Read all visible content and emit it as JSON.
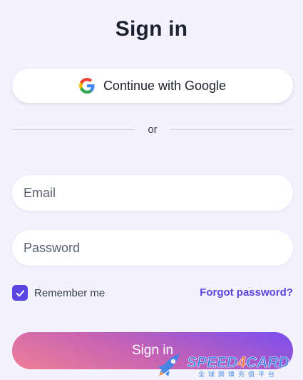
{
  "page": {
    "title": "Sign in"
  },
  "google": {
    "label": "Continue with Google",
    "icon": "google-g-logo"
  },
  "divider": {
    "text": "or"
  },
  "form": {
    "email_placeholder": "Email",
    "email_value": "",
    "password_placeholder": "Password",
    "password_value": "",
    "remember_label": "Remember me",
    "remember_checked": true,
    "forgot_label": "Forgot password?",
    "submit_label": "Sign in"
  },
  "watermark": {
    "brand": "SPEED4CARD",
    "tagline": "全球跨境充值平台"
  },
  "colors": {
    "background": "#f3f2fd",
    "accent": "#5b45e0",
    "button_gradient_start": "#ef7f96",
    "button_gradient_end": "#7a4ef0"
  }
}
